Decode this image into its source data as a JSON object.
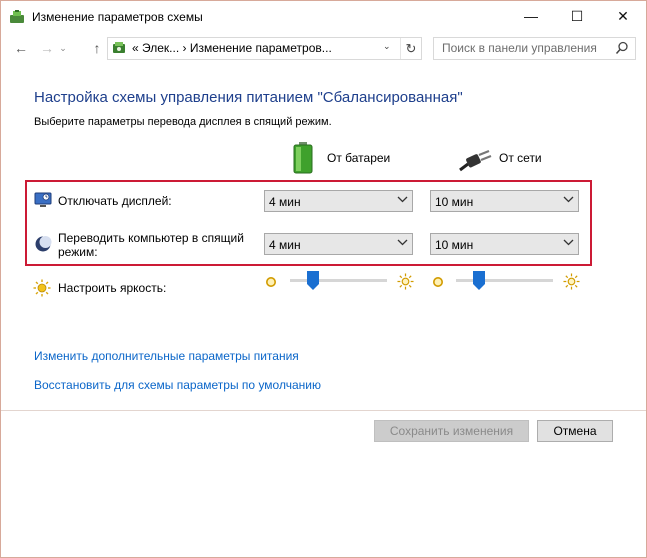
{
  "window": {
    "title": "Изменение параметров схемы",
    "minimize": "—",
    "maximize": "☐",
    "close": "✕"
  },
  "nav": {
    "back": "←",
    "forward": "→",
    "history": "⌄",
    "up": "↑",
    "address": "«  Элек... › Изменение параметров...",
    "address_dropdown": "⌄",
    "refresh": "↻",
    "search_placeholder": "Поиск в панели управления"
  },
  "page": {
    "heading": "Настройка схемы управления питанием \"Сбалансированная\"",
    "subtitle": "Выберите параметры перевода дисплея в спящий режим."
  },
  "columns": {
    "battery": "От батареи",
    "ac": "От сети"
  },
  "settings": [
    {
      "label": "Отключать дисплей:",
      "battery": "4 мин",
      "ac": "10 мин"
    },
    {
      "label": "Переводить компьютер в спящий режим:",
      "battery": "4 мин",
      "ac": "10 мин"
    }
  ],
  "brightness": {
    "label": "Настроить яркость:",
    "battery_level_pct": 20,
    "ac_level_pct": 20
  },
  "links": {
    "advanced": "Изменить дополнительные параметры питания",
    "restore": "Восстановить для схемы параметры по умолчанию"
  },
  "buttons": {
    "save": "Сохранить изменения",
    "cancel": "Отмена"
  },
  "colors": {
    "heading": "#1e3f8c",
    "link": "#0b66c9",
    "highlight": "#cc1a35",
    "slider_thumb": "#1a6fd1"
  }
}
